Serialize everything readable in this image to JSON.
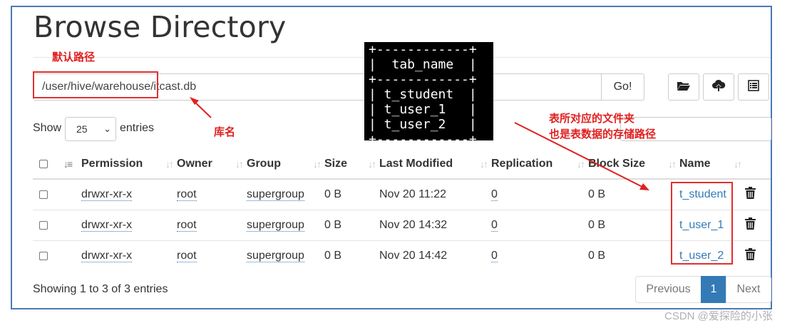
{
  "header": {
    "title": "Browse Directory"
  },
  "path_bar": {
    "value": "/user/hive/warehouse/itcast.db",
    "go_label": "Go!"
  },
  "toolbar": {
    "icons": [
      "folder-open-icon",
      "cloud-upload-icon",
      "list-icon"
    ]
  },
  "show_entries": {
    "show_label": "Show",
    "selected": "25",
    "entries_label": "entries"
  },
  "table": {
    "columns": [
      "Permission",
      "Owner",
      "Group",
      "Size",
      "Last Modified",
      "Replication",
      "Block Size",
      "Name"
    ],
    "rows": [
      {
        "permission": "drwxr-xr-x",
        "owner": "root",
        "group": "supergroup",
        "size": "0 B",
        "modified": "Nov 20 11:22",
        "replication": "0",
        "block_size": "0 B",
        "name": "t_student"
      },
      {
        "permission": "drwxr-xr-x",
        "owner": "root",
        "group": "supergroup",
        "size": "0 B",
        "modified": "Nov 20 14:32",
        "replication": "0",
        "block_size": "0 B",
        "name": "t_user_1"
      },
      {
        "permission": "drwxr-xr-x",
        "owner": "root",
        "group": "supergroup",
        "size": "0 B",
        "modified": "Nov 20 14:42",
        "replication": "0",
        "block_size": "0 B",
        "name": "t_user_2"
      }
    ]
  },
  "footer": {
    "showing": "Showing 1 to 3 of 3 entries"
  },
  "pagination": {
    "previous": "Previous",
    "current": "1",
    "next": "Next"
  },
  "terminal": {
    "lines": [
      "+------------+",
      "|  tab_name  |",
      "+------------+",
      "| t_student  |",
      "| t_user_1   |",
      "| t_user_2   |",
      "+------------+"
    ]
  },
  "annotations": {
    "default_path": "默认路径",
    "db_name": "库名",
    "table_folder_line1": "表所对应的文件夹",
    "table_folder_line2": "也是表数据的存储路径"
  },
  "watermark": "CSDN @爱探险的小张",
  "colors": {
    "link": "#337ab7",
    "annotation": "#e02020",
    "active_page": "#337ab7",
    "frame": "#4a78b8"
  }
}
